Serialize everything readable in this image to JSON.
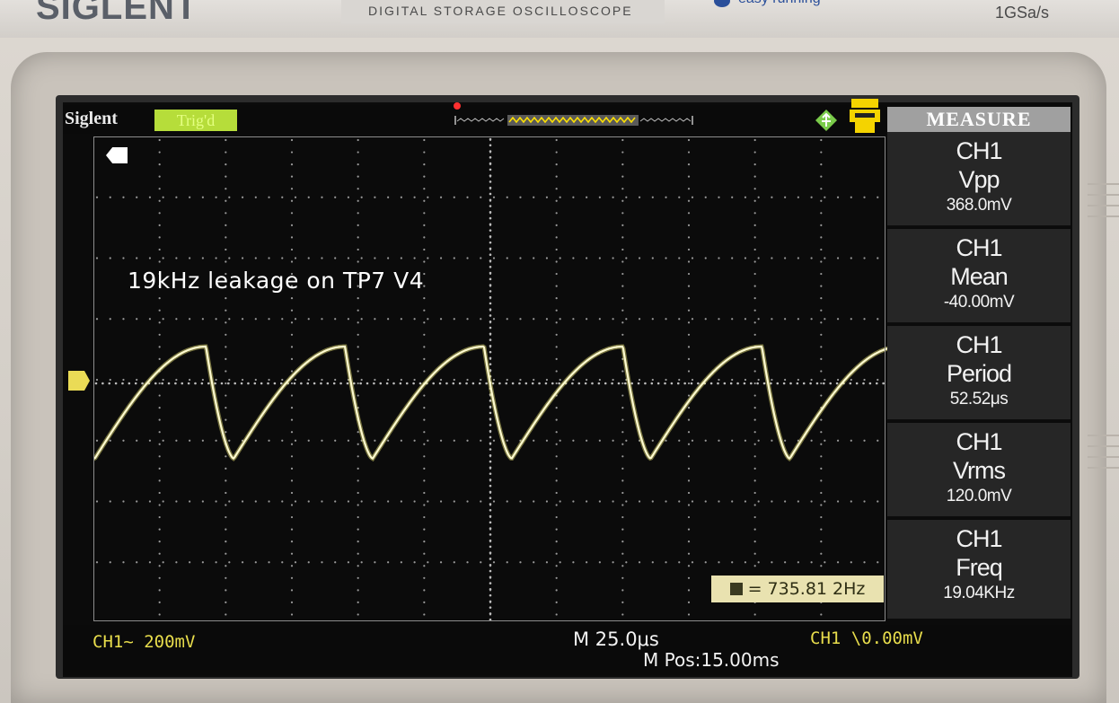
{
  "header": {
    "brand": "SIGLENT",
    "model_label": "DIGITAL STORAGE OSCILLOSCOPE",
    "tagline": "easy running",
    "sample_rate": "1GSa/s"
  },
  "status": {
    "brand": "Siglent",
    "trigger_state": "Trig'd"
  },
  "annotation": {
    "text": "19kHz leakage on TP7 V4"
  },
  "cursor_readout": {
    "text": "= 735.81 2Hz"
  },
  "measure": {
    "title": "MEASURE",
    "items": [
      {
        "channel": "CH1",
        "name": "Vpp",
        "value": "368.0mV"
      },
      {
        "channel": "CH1",
        "name": "Mean",
        "value": "-40.00mV"
      },
      {
        "channel": "CH1",
        "name": "Period",
        "value": "52.52μs"
      },
      {
        "channel": "CH1",
        "name": "Vrms",
        "value": "120.0mV"
      },
      {
        "channel": "CH1",
        "name": "Freq",
        "value": "19.04KHz"
      }
    ]
  },
  "bottom": {
    "ch1_scale": "CH1~ 200mV",
    "timebase": "M 25.0μs",
    "m_pos": "M Pos:15.00ms",
    "trigger_level": "CH1 \\0.00mV"
  },
  "colors": {
    "trace": "#f2ea7a",
    "trace_glow": "#ffffff",
    "trig_badge": "#b6dd3a",
    "channel1": "#e8dd4c"
  },
  "waveform": {
    "type": "sawtooth",
    "frequency_hz": 19040,
    "vpp_mv": 368.0,
    "timebase_us_per_div": 25.0,
    "volts_per_div_mv": 200
  }
}
